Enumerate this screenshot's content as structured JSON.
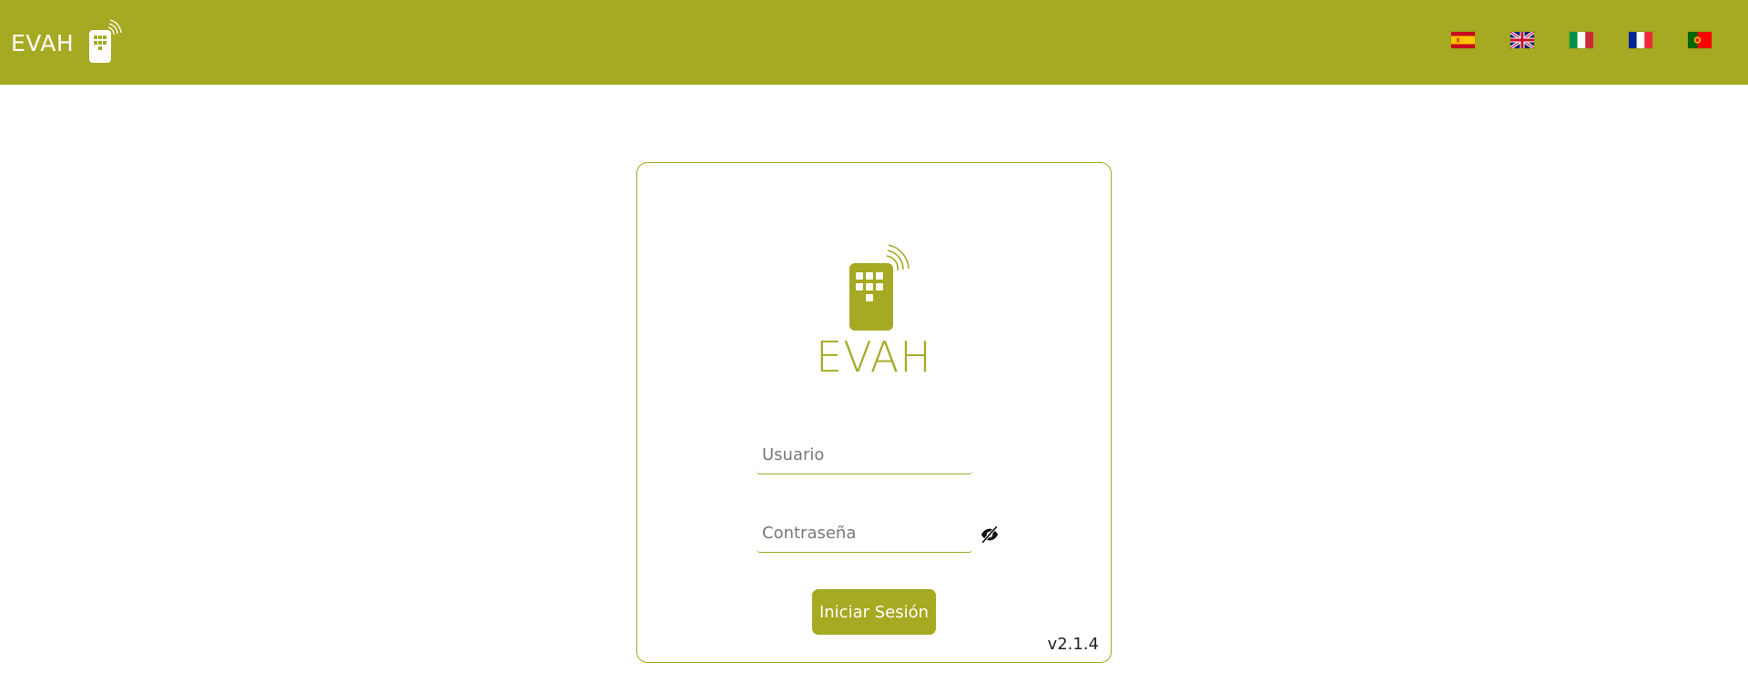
{
  "colors": {
    "brand": "#a6a922",
    "white": "#ffffff"
  },
  "header": {
    "brand_text": "EVAH",
    "brand_icon": "remote-control-icon",
    "languages": [
      {
        "code": "es",
        "icon": "flag-spain-icon"
      },
      {
        "code": "en",
        "icon": "flag-uk-icon"
      },
      {
        "code": "it",
        "icon": "flag-italy-icon"
      },
      {
        "code": "fr",
        "icon": "flag-france-icon"
      },
      {
        "code": "pt",
        "icon": "flag-portugal-icon"
      }
    ]
  },
  "login": {
    "logo_icon": "remote-control-icon",
    "logo_text": "EVAH",
    "username": {
      "value": "",
      "placeholder": "Usuario"
    },
    "password": {
      "value": "",
      "placeholder": "Contraseña",
      "toggle_icon": "eye-slash-icon"
    },
    "submit_label": "Iniciar Sesión",
    "version": "v2.1.4"
  }
}
